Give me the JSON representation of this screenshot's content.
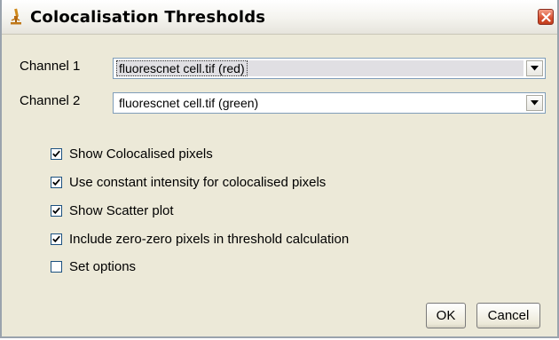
{
  "window": {
    "title": "Colocalisation Thresholds"
  },
  "channel1": {
    "label": "Channel 1",
    "value": "fluorescnet cell.tif (red)"
  },
  "channel2": {
    "label": "Channel 2",
    "value": "fluorescnet cell.tif (green)"
  },
  "options": [
    {
      "label": "Show Colocalised pixels",
      "checked": true
    },
    {
      "label": "Use constant intensity for colocalised pixels",
      "checked": true
    },
    {
      "label": "Show Scatter plot",
      "checked": true
    },
    {
      "label": "Include zero-zero pixels in threshold calculation",
      "checked": true
    },
    {
      "label": "Set options",
      "checked": false
    }
  ],
  "buttons": {
    "ok": "OK",
    "cancel": "Cancel"
  },
  "icons": {
    "app": "microscope-icon",
    "close": "close-icon",
    "dropdown": "chevron-down-icon",
    "check": "check-icon"
  },
  "colors": {
    "close_button": "#d8502f",
    "dialog_bg": "#ece9d8",
    "combo_border": "#7f9db9"
  }
}
